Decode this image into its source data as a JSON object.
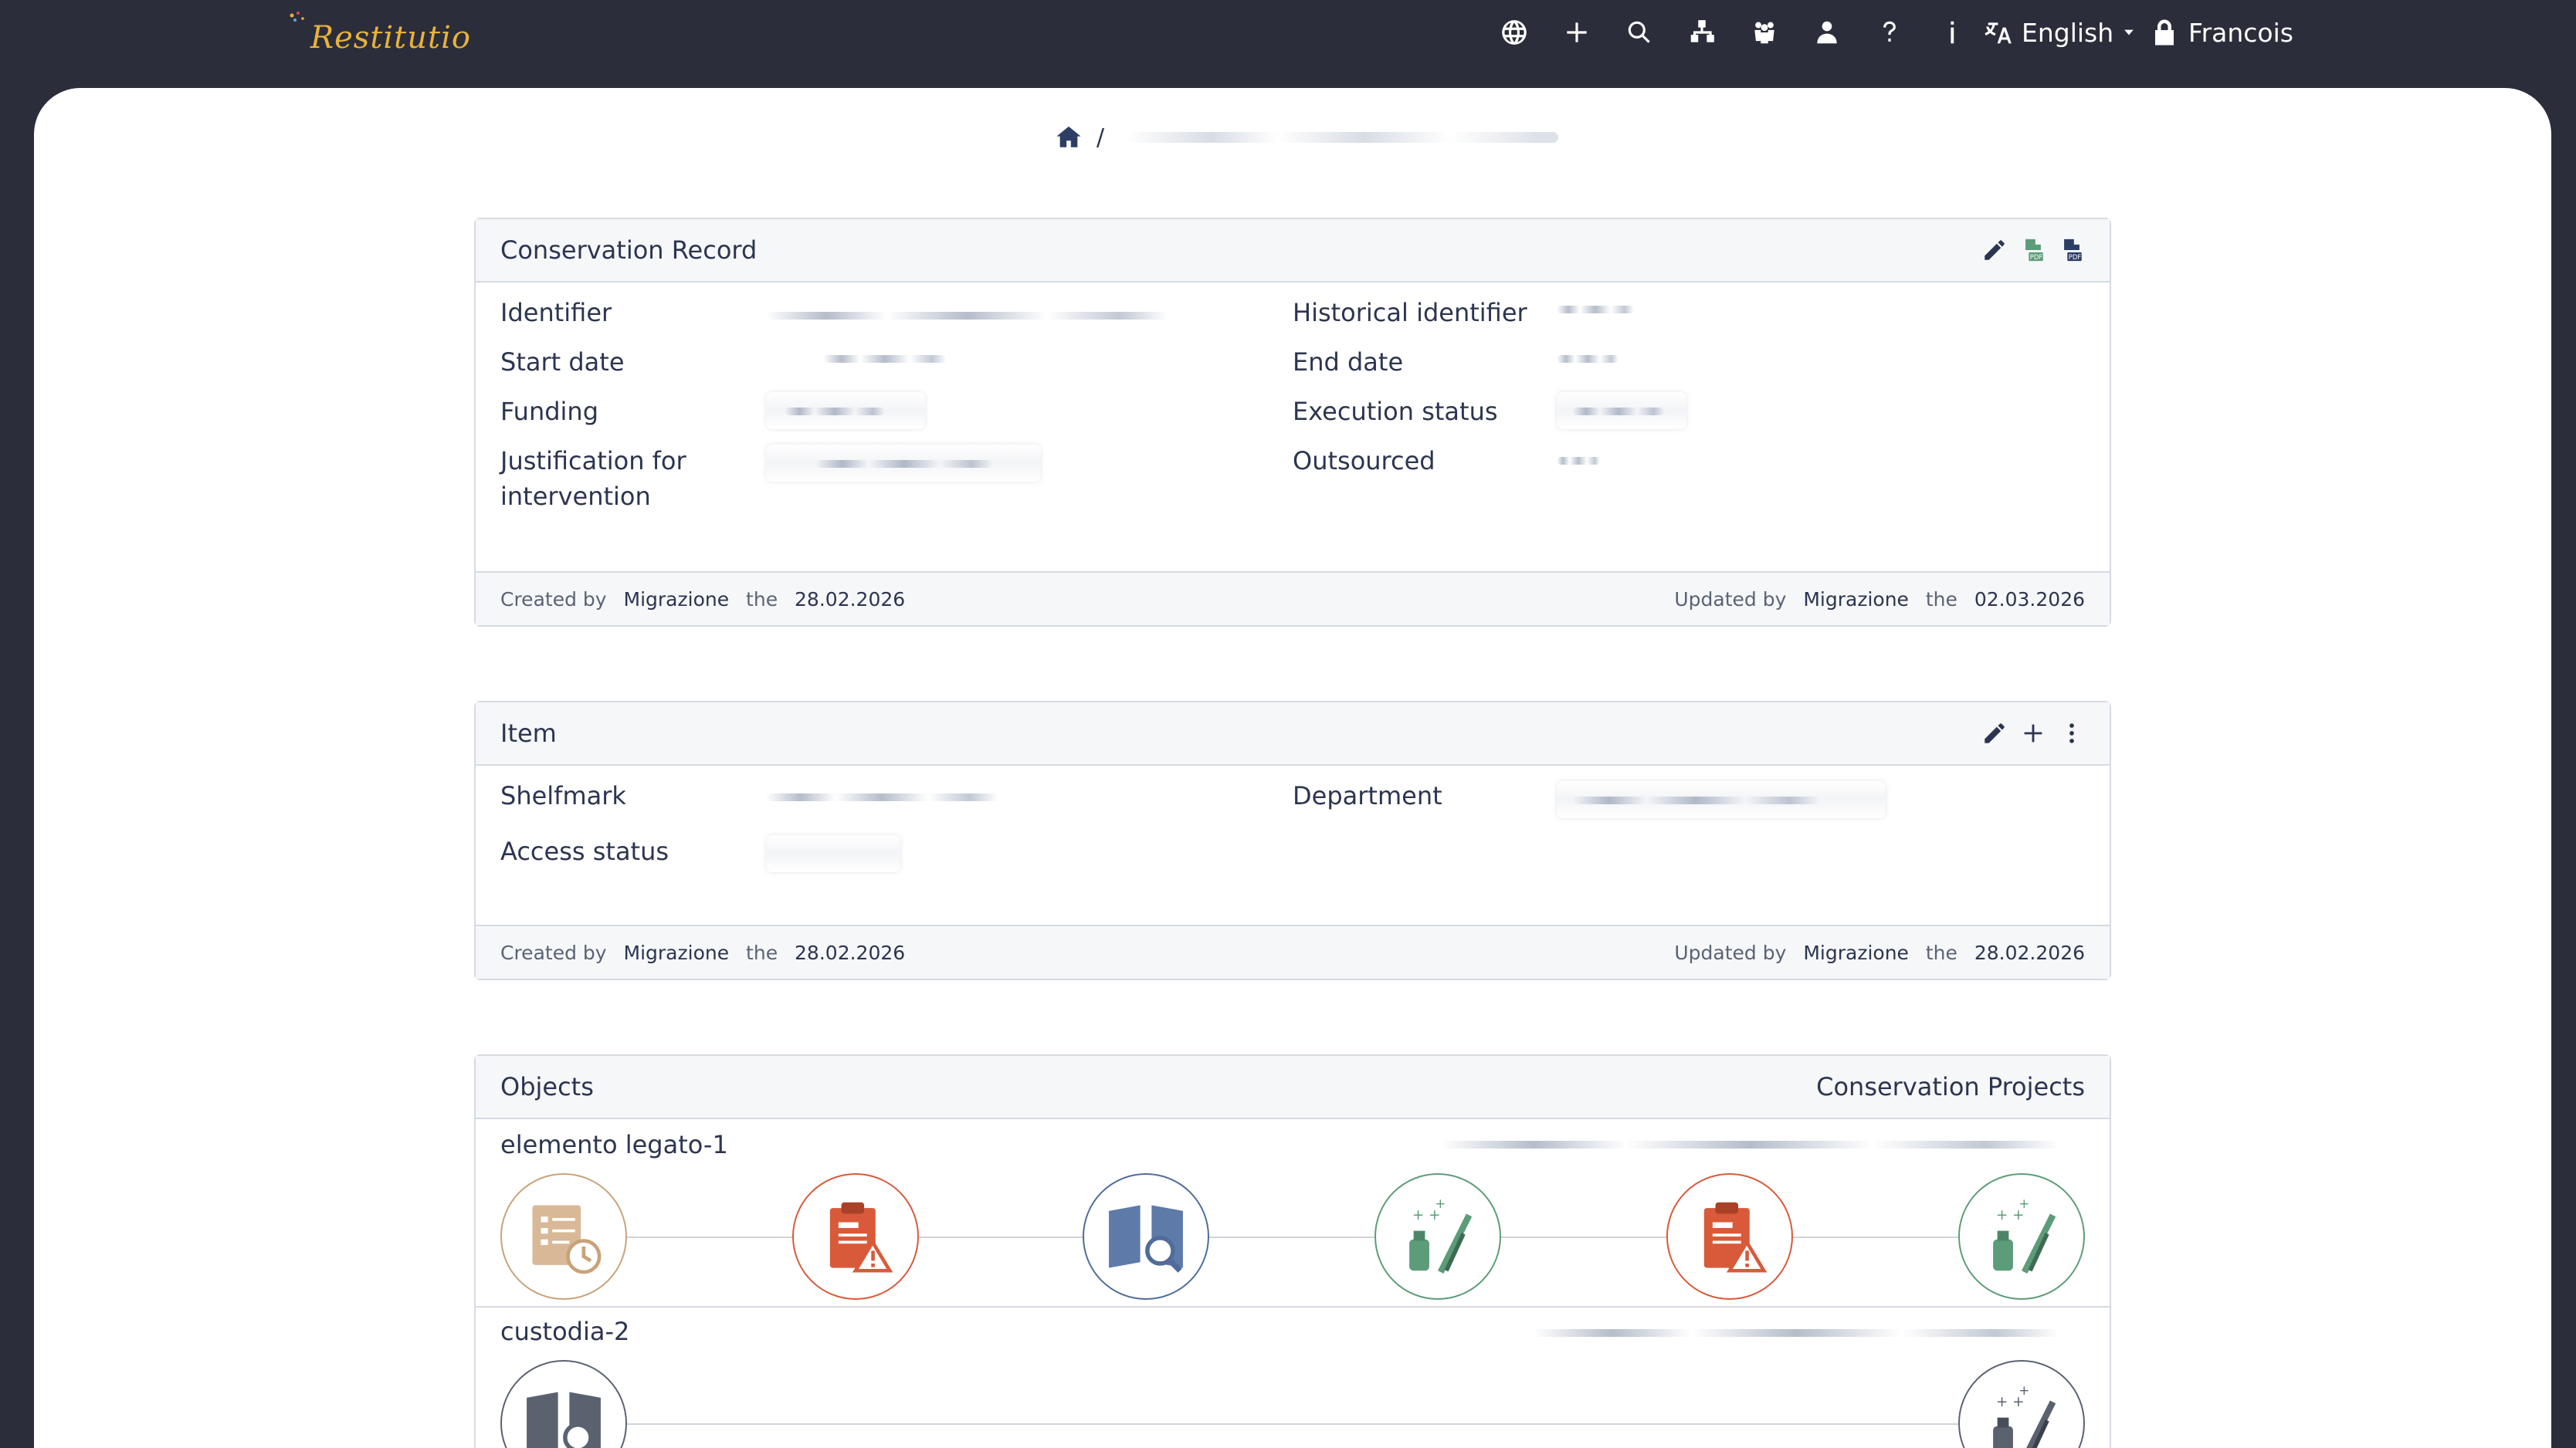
{
  "app": {
    "logo_text": "Restitutio",
    "nav_icons": [
      "globe-icon",
      "plus-icon",
      "search-icon",
      "sitemap-icon",
      "users-icon",
      "user-icon",
      "question-icon",
      "info-icon"
    ],
    "language": "English",
    "user": "Francois"
  },
  "breadcrumb": {
    "separator": "/"
  },
  "conservation_record": {
    "title": "Conservation Record",
    "fields": {
      "identifier_label": "Identifier",
      "historical_identifier_label": "Historical identifier",
      "start_date_label": "Start date",
      "end_date_label": "End date",
      "funding_label": "Funding",
      "execution_status_label": "Execution status",
      "justification_label": "Justification for intervention",
      "outsourced_label": "Outsourced"
    },
    "created_by_label": "Created by",
    "created_by": "Migrazione",
    "created_the": "the",
    "created_date": "28.02.2026",
    "updated_by_label": "Updated by",
    "updated_by": "Migrazione",
    "updated_the": "the",
    "updated_date": "02.03.2026"
  },
  "item": {
    "title": "Item",
    "fields": {
      "shelfmark_label": "Shelfmark",
      "department_label": "Department",
      "access_status_label": "Access status"
    },
    "created_by_label": "Created by",
    "created_by": "Migrazione",
    "created_the": "the",
    "created_date": "28.02.2026",
    "updated_by_label": "Updated by",
    "updated_by": "Migrazione",
    "updated_the": "the",
    "updated_date": "28.02.2026"
  },
  "objects": {
    "title": "Objects",
    "projects_label": "Conservation Projects",
    "rows": [
      {
        "label": "elemento legato-1",
        "icons": [
          "checklist-clock-icon",
          "report-warning-icon",
          "book-search-icon",
          "restoration-tools-icon",
          "report-warning-icon",
          "restoration-tools-icon"
        ]
      },
      {
        "label": "custodia-2",
        "icons": [
          "book-search-icon",
          "restoration-tools-icon"
        ]
      }
    ]
  },
  "colors": {
    "navbar": "#2b2d3a",
    "logo": "#e8b23a",
    "text": "#2c3550",
    "tan": "#c9a27a",
    "red": "#d85a3a",
    "blue": "#4f6c9a",
    "green": "#5c9c78",
    "dark": "#5a6270"
  }
}
